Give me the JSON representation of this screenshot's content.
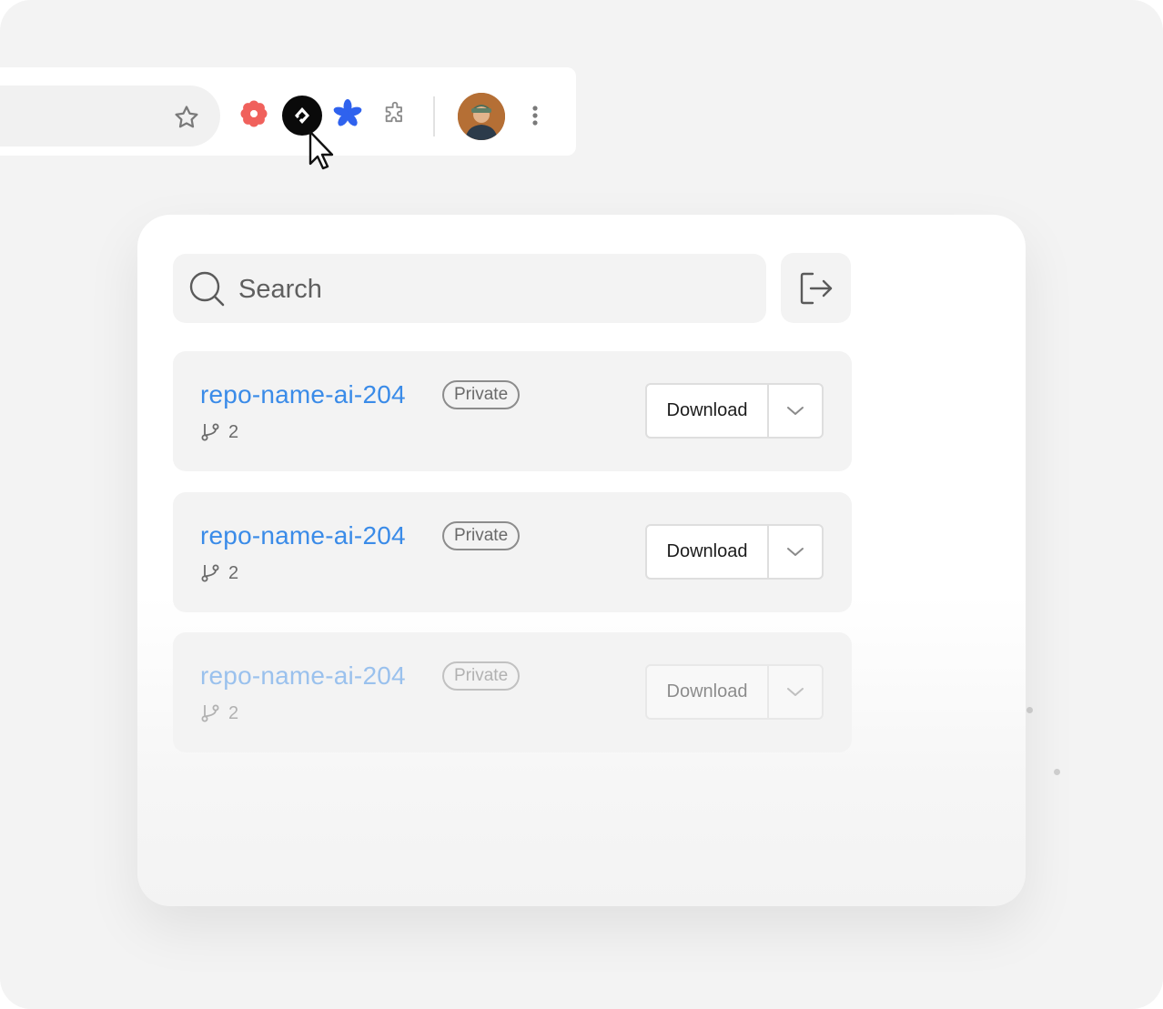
{
  "search": {
    "placeholder": "Search"
  },
  "toolbar": {
    "extensions": [
      "flower-icon",
      "app-logo-icon",
      "asterisk-icon",
      "puzzle-icon"
    ],
    "menu_icon": "kebab-menu-icon"
  },
  "repos": [
    {
      "name": "repo-name-ai-204",
      "visibility": "Private",
      "branches": "2",
      "download_label": "Download"
    },
    {
      "name": "repo-name-ai-204",
      "visibility": "Private",
      "branches": "2",
      "download_label": "Download"
    },
    {
      "name": "repo-name-ai-204",
      "visibility": "Private",
      "branches": "2",
      "download_label": "Download"
    }
  ],
  "colors": {
    "link": "#3a8be8",
    "red_ext": "#f0615c",
    "blue_ext": "#2f62ee"
  }
}
